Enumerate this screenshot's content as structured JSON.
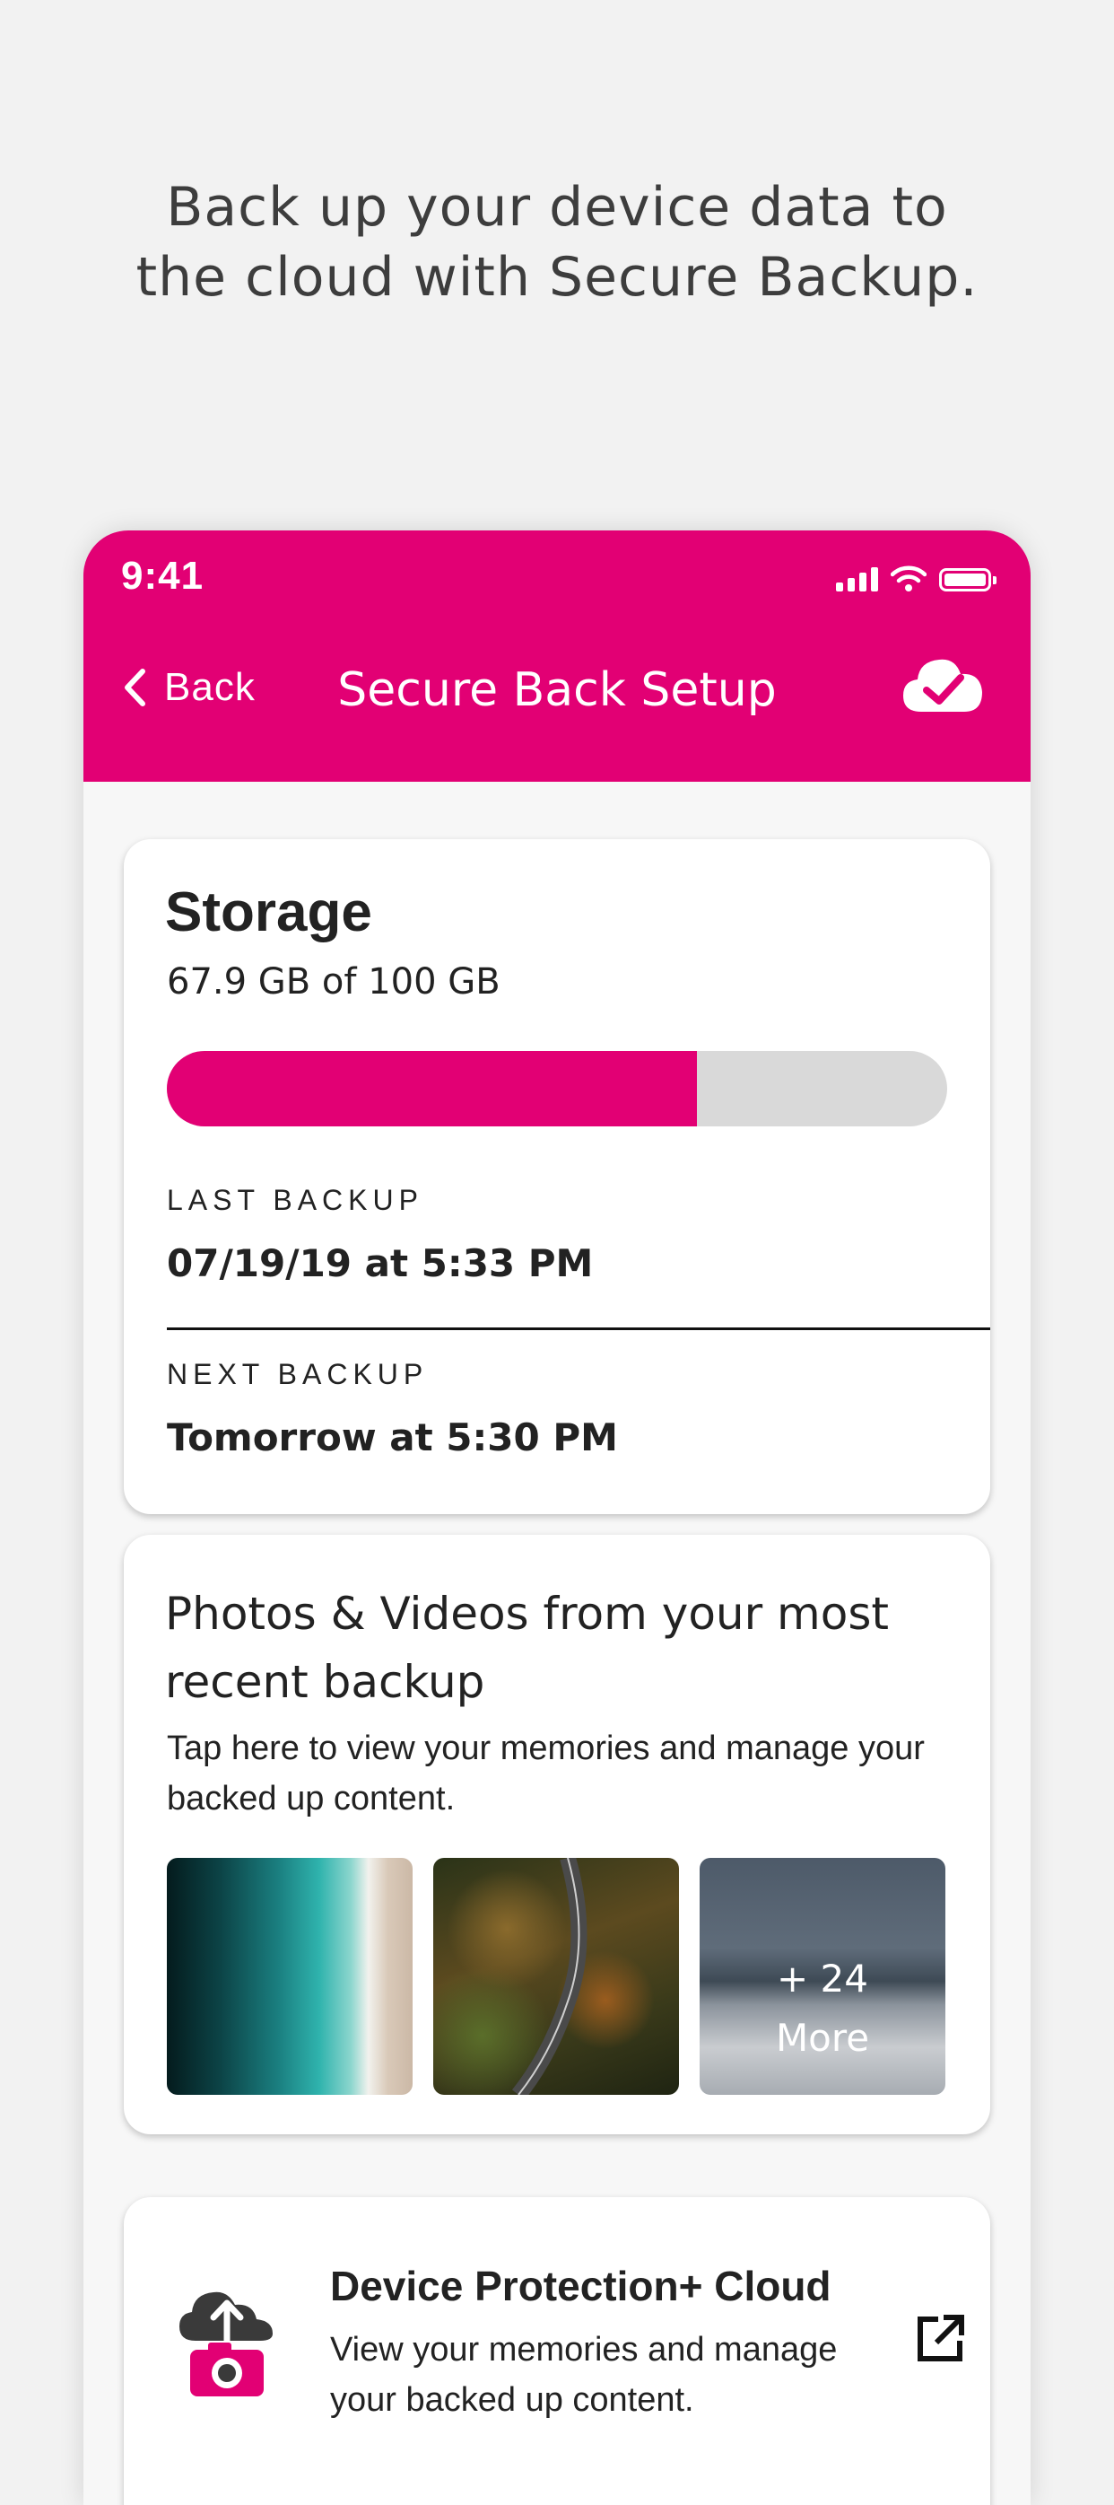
{
  "headline": {
    "line1": "Back up your device data to",
    "line2": "the cloud with Secure Backup."
  },
  "status_bar": {
    "time": "9:41",
    "icons": [
      "signal-icon",
      "wifi-icon",
      "battery-icon"
    ]
  },
  "nav": {
    "back_label": "Back",
    "title": "Secure Back Setup",
    "action_icon": "cloud-check-icon"
  },
  "storage": {
    "title": "Storage",
    "usage_text": "67.9 GB of 100 GB",
    "used_fraction": 0.679,
    "last_backup_label": "LAST BACKUP",
    "last_backup_value": "07/19/19 at 5:33 PM",
    "next_backup_label": "NEXT BACKUP",
    "next_backup_value": "Tomorrow at 5:30 PM"
  },
  "photos": {
    "title": "Photos & Videos from your most recent backup",
    "subtitle": "Tap here to view your memories and manage your backed up content.",
    "thumbnails": [
      "aerial beach",
      "forest road",
      "snowy forest"
    ],
    "more_line1": "+ 24",
    "more_line2": "More"
  },
  "device_protection": {
    "title": "Device Protection+ Cloud",
    "subtitle": "View your memories and manage your backed up content.",
    "icon": "cloud-camera-icon",
    "action_icon": "external-link-icon"
  },
  "colors": {
    "brand": "#e20074",
    "background": "#f2f2f2",
    "progress_track": "#d9d9d9"
  }
}
